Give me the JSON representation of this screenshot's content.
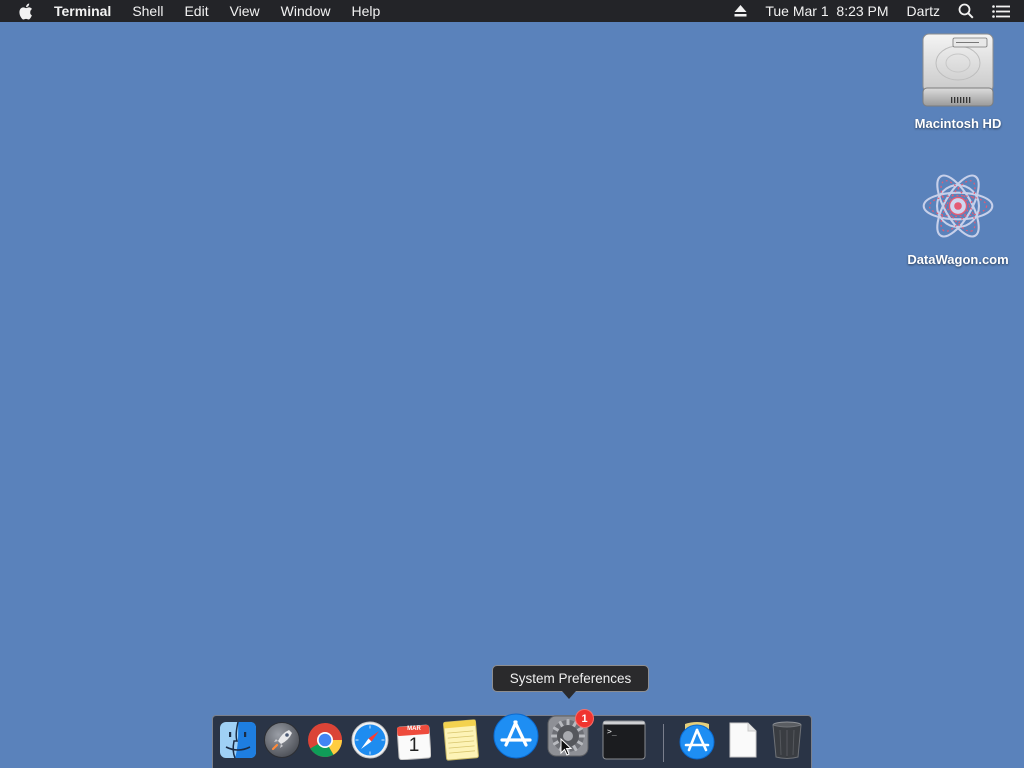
{
  "menubar": {
    "app_name": "Terminal",
    "items": [
      "Shell",
      "Edit",
      "View",
      "Window",
      "Help"
    ],
    "datetime": "Tue Mar 1  8:23 PM",
    "user": "Dartz"
  },
  "desktop": {
    "icons": [
      {
        "label": "Macintosh HD",
        "icon": "hard-drive-icon"
      },
      {
        "label": "DataWagon.com",
        "icon": "network-volume-icon"
      }
    ],
    "background_color": "#5a82bb"
  },
  "tooltip": {
    "text": "System Preferences"
  },
  "dock": {
    "apps": [
      {
        "name": "Finder",
        "icon": "finder-icon",
        "running": true
      },
      {
        "name": "Launchpad",
        "icon": "launchpad-icon",
        "running": false
      },
      {
        "name": "Google Chrome",
        "icon": "chrome-icon",
        "running": true
      },
      {
        "name": "Safari",
        "icon": "safari-icon",
        "running": false
      },
      {
        "name": "Calendar",
        "icon": "calendar-icon",
        "running": false,
        "month": "MAR",
        "day": "1"
      },
      {
        "name": "Notes",
        "icon": "notes-icon",
        "running": false
      },
      {
        "name": "App Store",
        "icon": "app-store-icon",
        "running": false
      },
      {
        "name": "System Preferences",
        "icon": "gear-icon",
        "running": false,
        "badge": "1"
      },
      {
        "name": "Terminal",
        "icon": "terminal-icon",
        "running": true
      }
    ],
    "others": [
      {
        "name": "Applications",
        "icon": "applications-folder-icon"
      },
      {
        "name": "Document",
        "icon": "document-icon"
      },
      {
        "name": "Trash",
        "icon": "trash-icon"
      }
    ]
  }
}
